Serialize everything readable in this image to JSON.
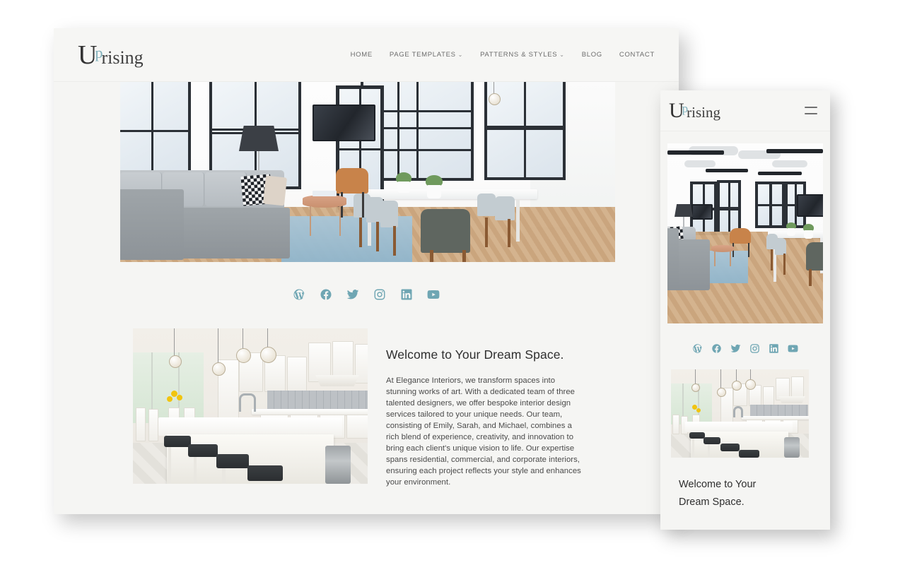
{
  "site": {
    "logo": {
      "part1": "U",
      "part2": "p",
      "part3": "rising"
    },
    "accent_color": "#7fb0bb",
    "social_color": "#6fa6b3",
    "card_background": "#f5f5f3",
    "page_background": "#ffffff"
  },
  "desktop": {
    "nav": [
      {
        "label": "HOME",
        "has_dropdown": false
      },
      {
        "label": "PAGE TEMPLATES",
        "has_dropdown": true,
        "chevron": "⌄"
      },
      {
        "label": "PATTERNS & STYLES",
        "has_dropdown": true,
        "chevron": "⌄"
      },
      {
        "label": "BLOG",
        "has_dropdown": false
      },
      {
        "label": "CONTACT",
        "has_dropdown": false
      }
    ],
    "hero_image_alt": "Bright modern loft living room with gray sectional sofa, black framed windows, blue rug and white dining table",
    "content_image_alt": "White kitchen with large island, dark leather barstools and pendant lights",
    "content_title": "Welcome to Your Dream Space.",
    "content_body": "At Elegance Interiors, we transform spaces into stunning works of art. With a dedicated team of three talented designers, we offer bespoke interior design services tailored to your unique needs. Our team, consisting of Emily, Sarah, and Michael, combines a rich blend of experience, creativity, and innovation to bring each client's unique vision to life. Our expertise spans residential, commercial, and corporate interiors, ensuring each project reflects your style and enhances your environment."
  },
  "mobile": {
    "menu_icon": "hamburger-icon",
    "hero_image_alt": "Wide view of modern loft with exposed ceiling ducts, gray sofa, tan chair and herringbone floor",
    "content_image_alt": "White kitchen with island and barstools",
    "title_line1": "Welcome to Your",
    "title_line2": "Dream Space."
  },
  "social": [
    {
      "name": "wordpress",
      "label": "WordPress"
    },
    {
      "name": "facebook",
      "label": "Facebook"
    },
    {
      "name": "twitter",
      "label": "Twitter"
    },
    {
      "name": "instagram",
      "label": "Instagram"
    },
    {
      "name": "linkedin",
      "label": "LinkedIn"
    },
    {
      "name": "youtube",
      "label": "YouTube"
    }
  ]
}
